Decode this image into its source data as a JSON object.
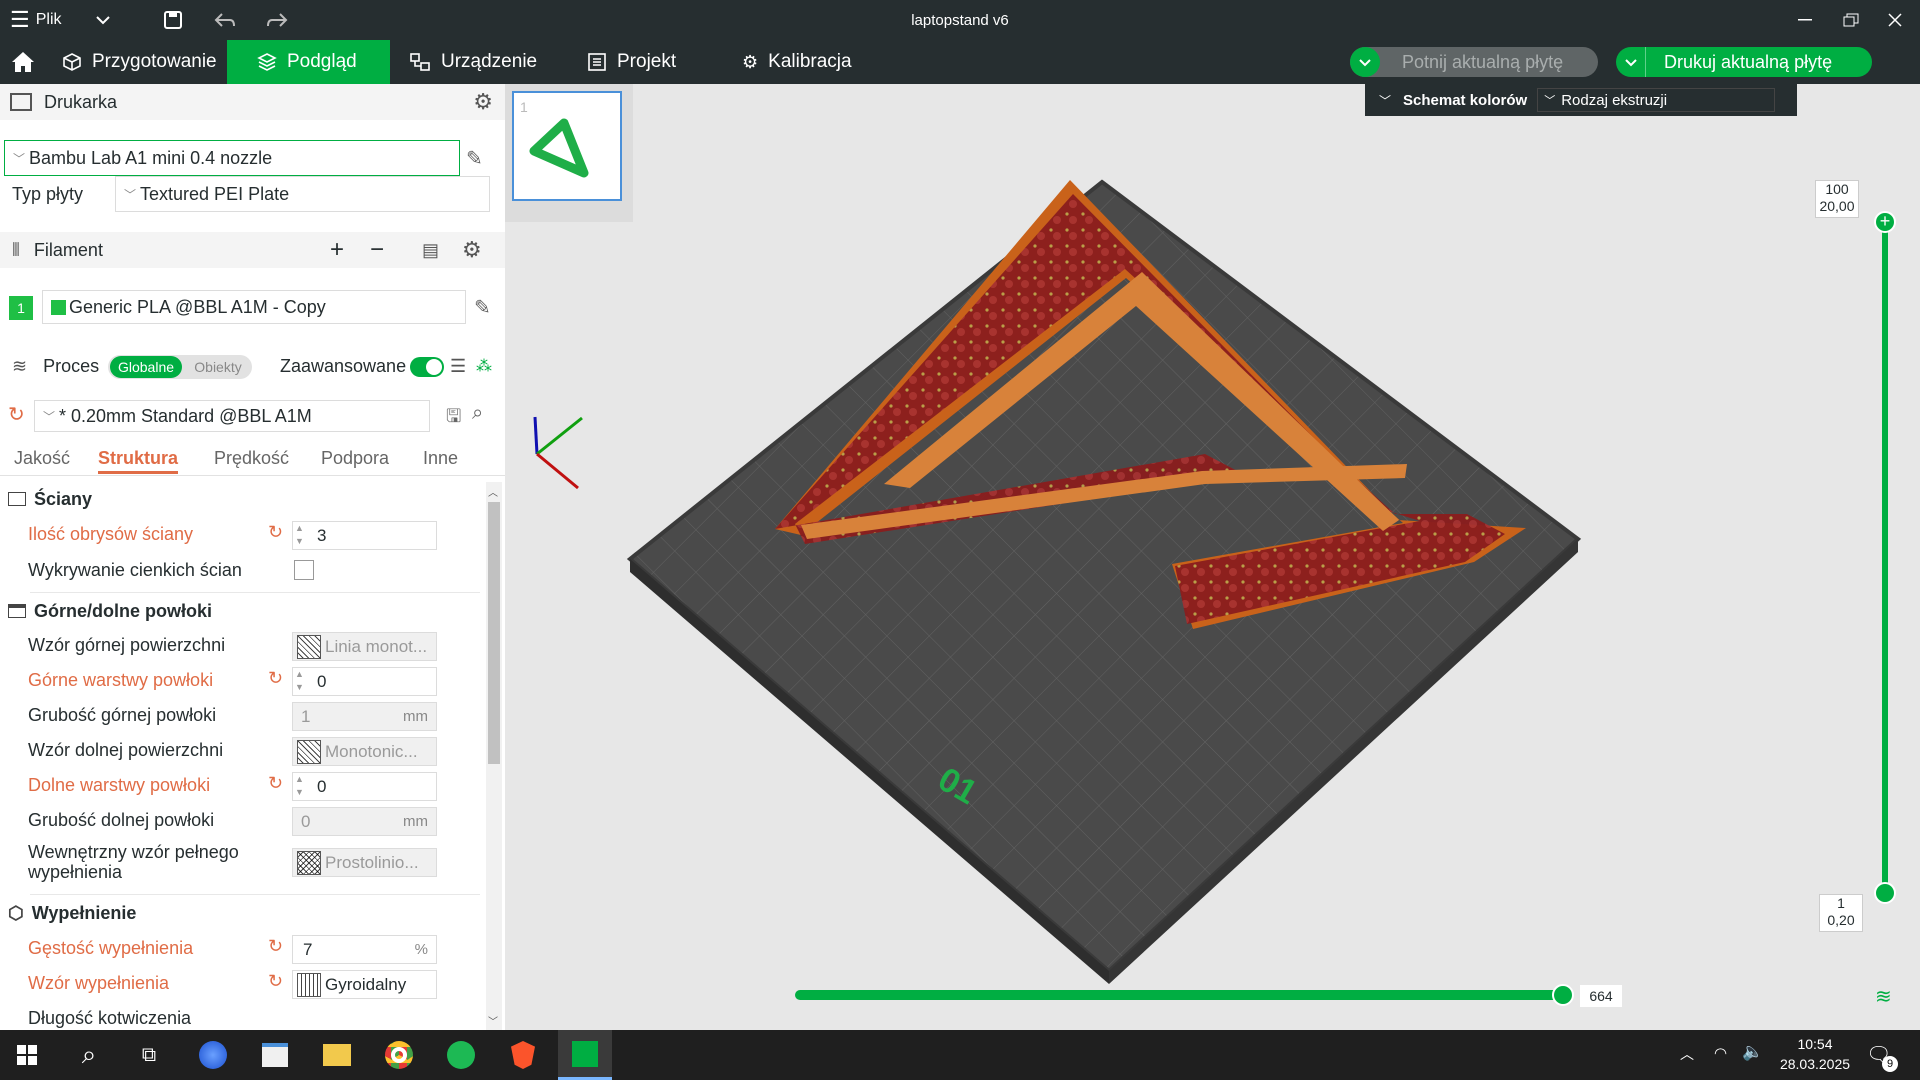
{
  "app": {
    "menu_label": "Plik",
    "window_title": "laptopstand v6"
  },
  "tabs": [
    {
      "label": "Przygotowanie"
    },
    {
      "label": "Podgląd"
    },
    {
      "label": "Urządzenie"
    },
    {
      "label": "Projekt"
    },
    {
      "label": "Kalibracja"
    }
  ],
  "actions": {
    "slice": "Potnij aktualną płytę",
    "print": "Drukuj aktualną płytę"
  },
  "printer": {
    "section": "Drukarka",
    "model": "Bambu Lab A1 mini 0.4 nozzle",
    "plate_label": "Typ płyty",
    "plate": "Textured PEI Plate"
  },
  "filament": {
    "section": "Filament",
    "slot": "1",
    "name": "Generic PLA @BBL A1M - Copy",
    "color": "#1fbf45"
  },
  "process": {
    "section": "Proces",
    "toggle_global": "Globalne",
    "toggle_objects": "Obiekty",
    "advanced_label": "Zaawansowane",
    "preset": "* 0.20mm Standard @BBL A1M",
    "tabs": [
      "Jakość",
      "Struktura",
      "Prędkość",
      "Podpora",
      "Inne"
    ],
    "active_tab": "Struktura"
  },
  "settings": {
    "walls": {
      "title": "Ściany",
      "wall_loops_label": "Ilość obrysów ściany",
      "wall_loops": "3",
      "thin_walls_label": "Wykrywanie cienkich ścian"
    },
    "shells": {
      "title": "Górne/dolne powłoki",
      "top_pattern_label": "Wzór górnej powierzchni",
      "top_pattern": "Linia monot...",
      "top_layers_label": "Górne warstwy powłoki",
      "top_layers": "0",
      "top_thickness_label": "Grubość górnej powłoki",
      "top_thickness": "1",
      "bottom_pattern_label": "Wzór dolnej powierzchni",
      "bottom_pattern": "Monotonic...",
      "bottom_layers_label": "Dolne warstwy powłoki",
      "bottom_layers": "0",
      "bottom_thickness_label": "Grubość dolnej powłoki",
      "bottom_thickness": "0",
      "internal_pattern_label": "Wewnętrzny wzór pełnego wypełnienia",
      "internal_pattern": "Prostolinio...",
      "unit_mm": "mm"
    },
    "infill": {
      "title": "Wypełnienie",
      "density_label": "Gęstość wypełnienia",
      "density": "7",
      "density_unit": "%",
      "pattern_label": "Wzór wypełnienia",
      "pattern": "Gyroidalny",
      "anchor_label": "Długość kotwiczenia"
    }
  },
  "viewport": {
    "color_scheme_label": "Schemat kolorów",
    "color_scheme_value": "Rodzaj ekstruzji",
    "plate_thumb_index": "1",
    "plate_number": "01",
    "layer_top": "100",
    "layer_top_height": "20,00",
    "layer_bottom": "1",
    "layer_bottom_height": "0,20",
    "move_count": "664"
  },
  "taskbar": {
    "time": "10:54",
    "date": "28.03.2025",
    "notifications": "9"
  },
  "colors": {
    "accent": "#00ae42",
    "dark": "#262e30",
    "modified": "#e06c46"
  }
}
